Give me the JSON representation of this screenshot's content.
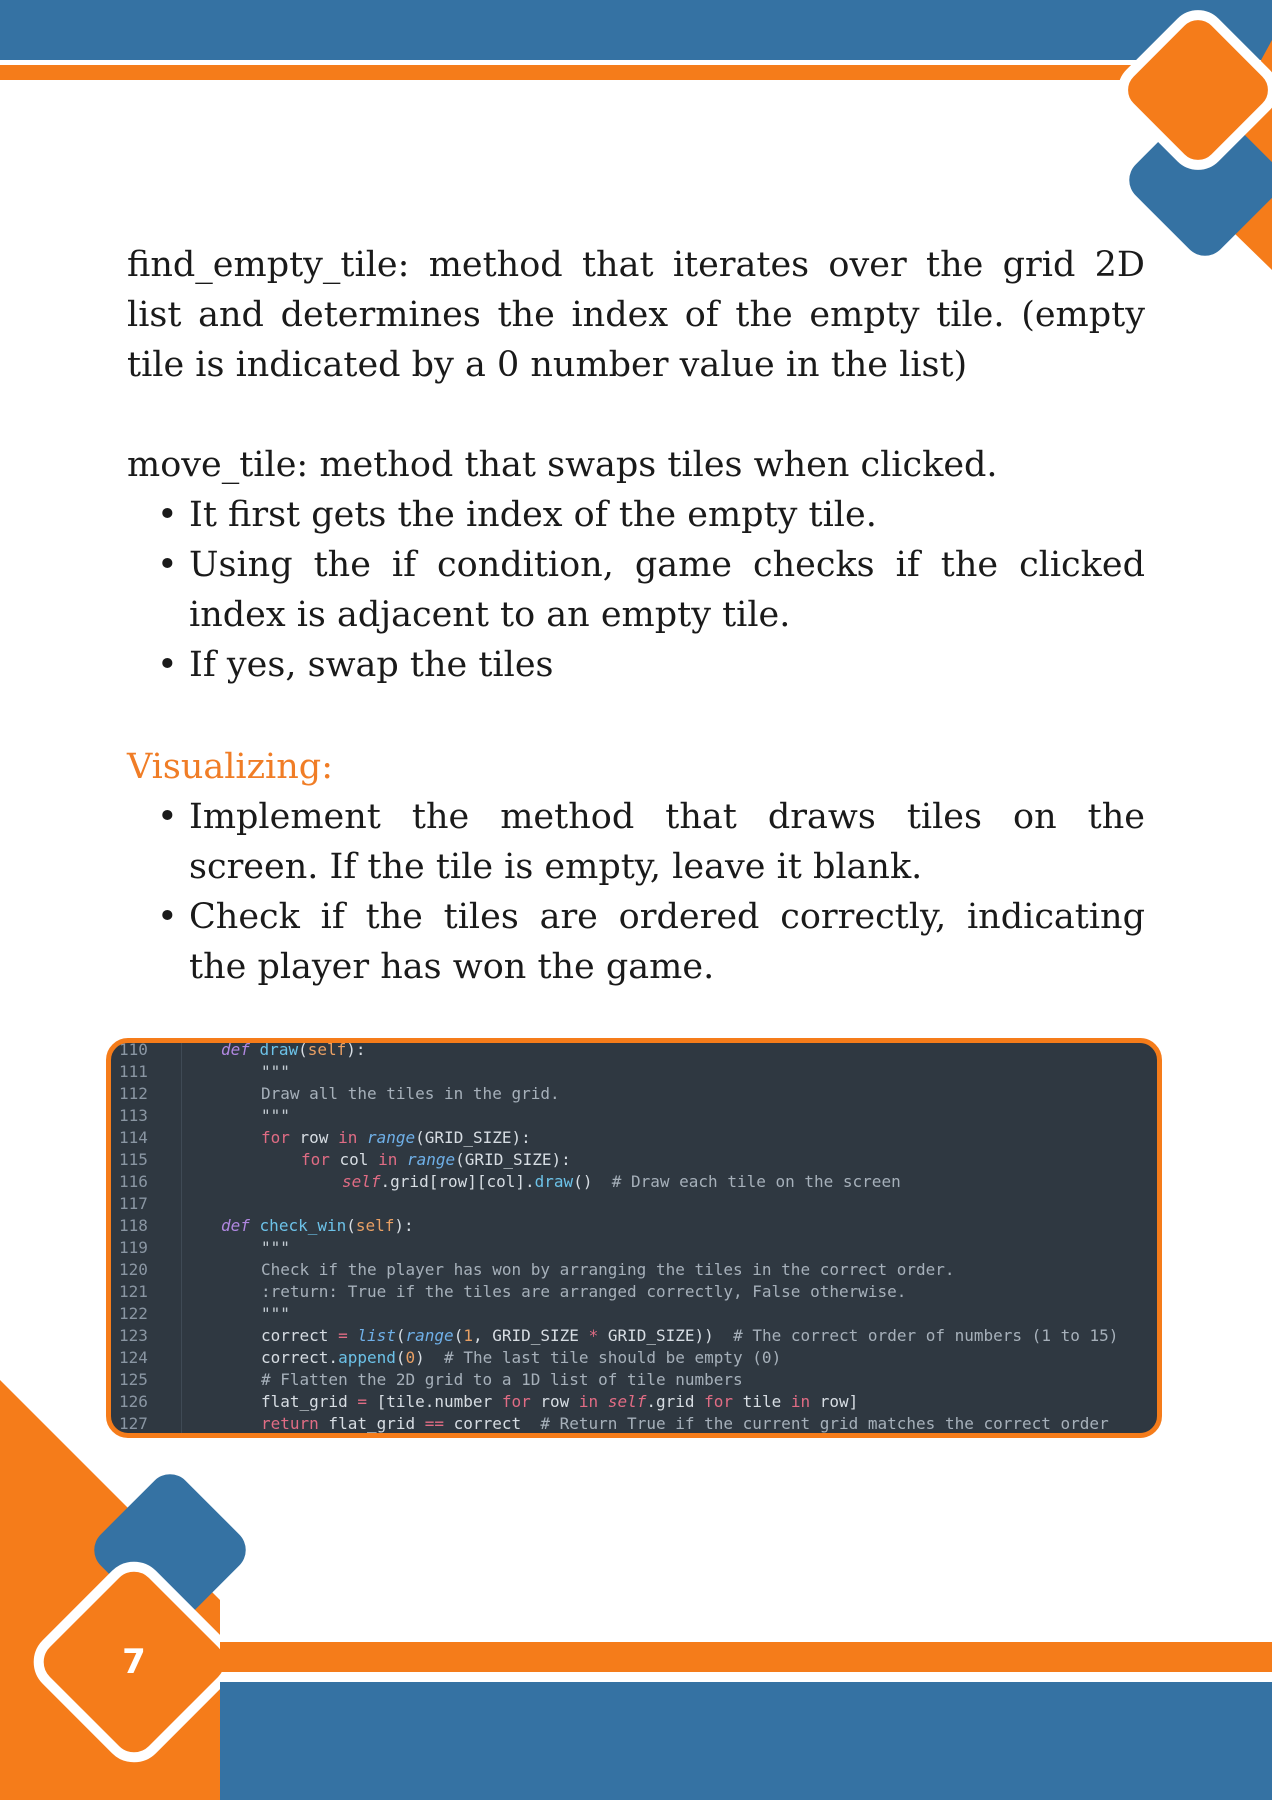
{
  "doc": {
    "para1": "find_empty_tile: method that iterates over the grid 2D list and determines the index of the empty tile. (empty tile is indicated by a 0 number value in the list)",
    "para2": "move_tile: method that swaps tiles when clicked.",
    "bullets1": [
      "It first gets the index of the empty tile.",
      "Using the if condition, game checks if the clicked index is adjacent to an empty tile.",
      "If yes, swap the tiles"
    ],
    "heading": "Visualizing:",
    "bullets2": [
      "Implement the method that draws tiles on the screen. If the tile is empty, leave it blank.",
      "Check if the tiles are ordered correctly, indicating the player has won the game."
    ],
    "page_number": "7"
  },
  "code": {
    "line_numbers": [
      "110",
      "111",
      "112",
      "113",
      "114",
      "115",
      "116",
      "117",
      "118",
      "119",
      "120",
      "121",
      "122",
      "123",
      "124",
      "125",
      "126",
      "127"
    ]
  },
  "colors": {
    "accent_orange": "#f57c1a",
    "accent_blue": "#3572a3",
    "heading_orange": "#f07d26",
    "code_bg": "#2f3841"
  }
}
